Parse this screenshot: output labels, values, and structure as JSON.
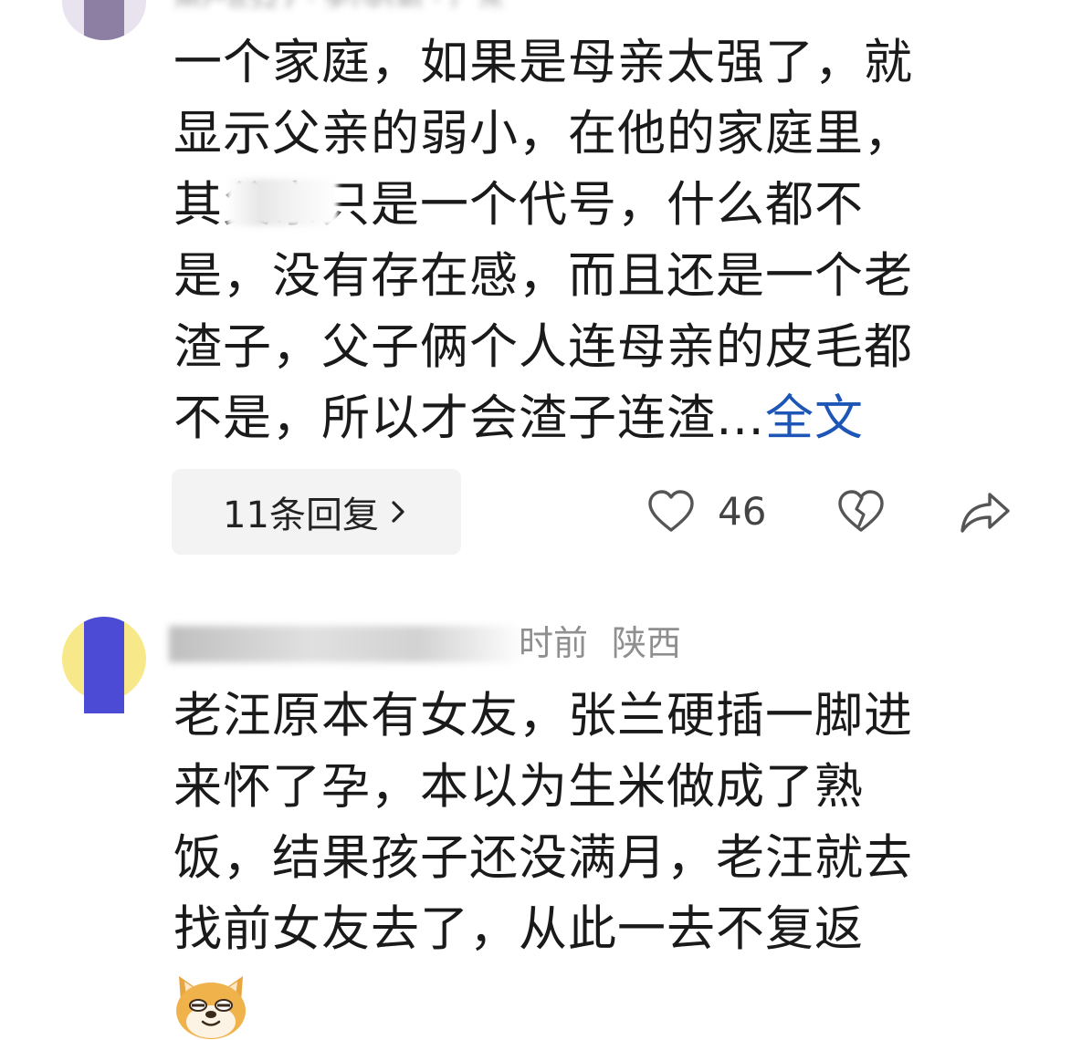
{
  "comment1": {
    "text": "一个家庭，如果是母亲太强了，就\n显示父亲的弱小，在他的家庭里，\n其父亲只是一个代号，什么都不\n是，没有存在感，而且还是一个老\n渣子，父子俩个人连母亲的皮毛都\n不是，所以才会渣子连渣…",
    "full_text_link": "全文",
    "reply_label": "11条回复",
    "like_count": "46"
  },
  "comment2": {
    "meta_time": "时前",
    "meta_region": "陕西",
    "text": "老汪原本有女友，张兰硬插一脚进\n来怀了孕，本以为生米做成了熟\n饭，结果孩子还没满月，老汪就去\n找前女友去了，从此一去不复返"
  },
  "icons": {
    "like": "heart-outline-icon",
    "dislike": "broken-heart-icon",
    "share": "share-arrow-icon",
    "reply_chevron": "chevron-right-icon",
    "emoji": "shiba-doge-emoji"
  },
  "colors": {
    "link": "#1d56b6",
    "meta": "#8f8f8f"
  }
}
